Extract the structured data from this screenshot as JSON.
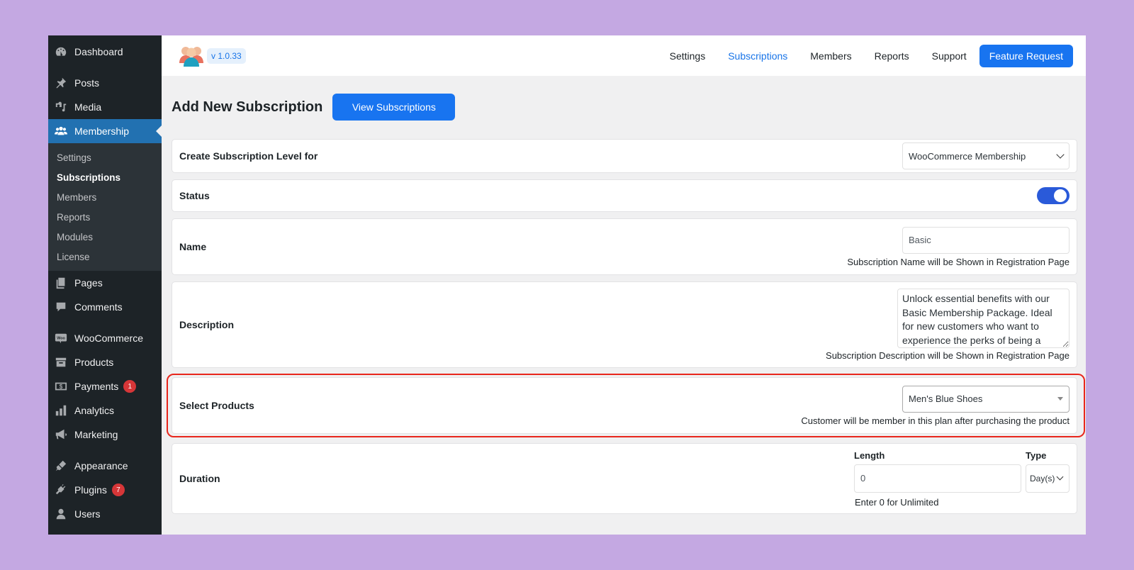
{
  "sidebar": {
    "items": [
      {
        "label": "Dashboard",
        "icon": "dashboard-icon"
      },
      {
        "label": "Posts",
        "icon": "pin-icon"
      },
      {
        "label": "Media",
        "icon": "media-icon"
      },
      {
        "label": "Membership",
        "icon": "users-icon",
        "active": true
      },
      {
        "label": "Pages",
        "icon": "pages-icon"
      },
      {
        "label": "Comments",
        "icon": "comment-icon"
      },
      {
        "label": "WooCommerce",
        "icon": "woo-icon"
      },
      {
        "label": "Products",
        "icon": "archive-icon"
      },
      {
        "label": "Payments",
        "icon": "dollar-icon",
        "badge": "1"
      },
      {
        "label": "Analytics",
        "icon": "bar-chart-icon"
      },
      {
        "label": "Marketing",
        "icon": "megaphone-icon"
      },
      {
        "label": "Appearance",
        "icon": "brush-icon"
      },
      {
        "label": "Plugins",
        "icon": "plug-icon",
        "badge": "7"
      },
      {
        "label": "Users",
        "icon": "user-icon"
      }
    ],
    "submenu": [
      "Settings",
      "Subscriptions",
      "Members",
      "Reports",
      "Modules",
      "License"
    ],
    "submenu_current": "Subscriptions"
  },
  "header": {
    "version": "v 1.0.33",
    "nav": [
      "Settings",
      "Subscriptions",
      "Members",
      "Reports",
      "Support"
    ],
    "nav_active": "Subscriptions",
    "feature_request": "Feature Request"
  },
  "page": {
    "title": "Add New Subscription",
    "view_button": "View Subscriptions"
  },
  "form": {
    "level": {
      "label": "Create Subscription Level for",
      "value": "WooCommerce Membership"
    },
    "status": {
      "label": "Status",
      "enabled": true
    },
    "name": {
      "label": "Name",
      "value": "Basic",
      "help": "Subscription Name will be Shown in Registration Page"
    },
    "description": {
      "label": "Description",
      "value": "Unlock essential benefits with our Basic Membership Package. Ideal for new customers who want to experience the perks of being a member.",
      "help": "Subscription Description will be Shown in Registration Page"
    },
    "products": {
      "label": "Select Products",
      "value": "Men's Blue Shoes",
      "help": "Customer will be member in this plan after purchasing the product"
    },
    "duration": {
      "label": "Duration",
      "length_label": "Length",
      "length_value": "0",
      "type_label": "Type",
      "type_value": "Day(s)",
      "help": "Enter 0 for Unlimited"
    }
  },
  "colors": {
    "accent": "#1874f0",
    "wp_active": "#2271b1",
    "highlight": "#e8261c",
    "toggle": "#2a5ad9"
  }
}
